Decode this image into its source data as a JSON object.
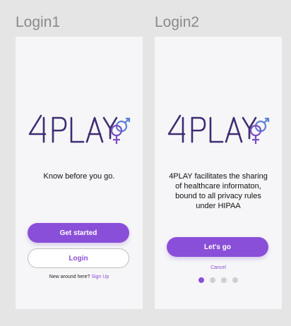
{
  "frames": [
    {
      "title": "Login1",
      "logo_text": "4PLAY",
      "tagline": "Know before you go.",
      "primary_button": "Get started",
      "secondary_button": "Login",
      "footer_text": "New around here?",
      "footer_link": "Sign Up"
    },
    {
      "title": "Login2",
      "logo_text": "4PLAY",
      "tagline": "4PLAY facilitates the sharing of healthcare informaton, bound to all privacy rules under HIPAA",
      "primary_button": "Let's go",
      "cancel_link": "Cancel",
      "pagination": {
        "total": 4,
        "active_index": 0
      }
    }
  ],
  "colors": {
    "background": "#e5e5e5",
    "screen": "#f6f6f8",
    "logo_purple": "#3f2c73",
    "accent": "#8a4fd8",
    "icon_blue": "#5f7fd6",
    "icon_purple": "#7a4fc0"
  }
}
